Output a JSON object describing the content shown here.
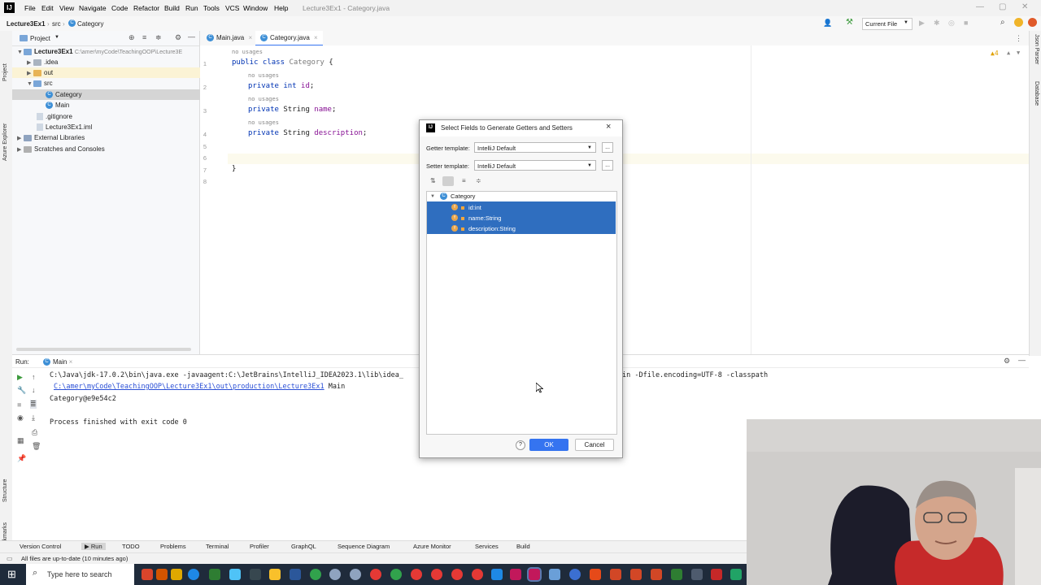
{
  "menubar": {
    "logo": "IJ",
    "items": [
      "File",
      "Edit",
      "View",
      "Navigate",
      "Code",
      "Refactor",
      "Build",
      "Run",
      "Tools",
      "VCS",
      "Window",
      "Help"
    ],
    "window_title": "Lecture3Ex1 - Category.java",
    "controls": [
      "—",
      "▢",
      "✕"
    ]
  },
  "navbar": {
    "breadcrumb": [
      "Lecture3Ex1",
      "src",
      "Category"
    ],
    "run_config": "Current File"
  },
  "left_stripe": {
    "project": "Project",
    "azure": "Azure Explorer",
    "structure": "Structure",
    "bookmarks": "Bookmarks"
  },
  "right_stripe": {
    "json": "Json Parser",
    "database": "Database"
  },
  "project_panel": {
    "title": "Project",
    "tree": [
      {
        "label": "Lecture3Ex1",
        "path": "C:\\amer\\myCode\\TeachingOOP\\Lecture3E",
        "bold": true
      },
      {
        "label": ".idea"
      },
      {
        "label": "out"
      },
      {
        "label": "src"
      },
      {
        "label": "Category"
      },
      {
        "label": "Main"
      },
      {
        "label": ".gitignore"
      },
      {
        "label": "Lecture3Ex1.iml"
      },
      {
        "label": "External Libraries"
      },
      {
        "label": "Scratches and Consoles"
      }
    ]
  },
  "editor": {
    "tabs": [
      "Main.java",
      "Category.java"
    ],
    "warnings": "▲4",
    "line_numbers": [
      "1",
      "2",
      "3",
      "4",
      "5",
      "6",
      "7",
      "8"
    ],
    "hints": [
      "no usages",
      "no usages",
      "no usages",
      "no usages"
    ],
    "lines": {
      "l1_kw": "public class ",
      "l1_name": "Category",
      "l1_end": " {",
      "l2_kw": "private int ",
      "l2_field": "id",
      "l2_end": ";",
      "l3_kw": "private ",
      "l3_type": "String ",
      "l3_field": "name",
      "l3_end": ";",
      "l4_kw": "private ",
      "l4_type": "String ",
      "l4_field": "description",
      "l4_end": ";",
      "l7": "}"
    }
  },
  "run_panel": {
    "label": "Run:",
    "tab": "Main",
    "cmd_left": "C:\\Java\\jdk-17.0.2\\bin\\java.exe -javaagent:C:\\JetBrains\\IntelliJ_IDEA2023.1\\lib\\idea_",
    "cmd_right": "in -Dfile.encoding=UTF-8 -classpath",
    "path_link": "C:\\amer\\myCode\\TeachingOOP\\Lecture3Ex1\\out\\production\\Lecture3Ex1",
    "path_suffix": " Main",
    "output": "Category@e9e54c2",
    "finished": "Process finished with exit code 0"
  },
  "tool_windows": [
    "Version Control",
    "Run",
    "TODO",
    "Problems",
    "Terminal",
    "Profiler",
    "GraphQL",
    "Sequence Diagram",
    "Azure Monitor",
    "Services",
    "Build"
  ],
  "status": "All files are up-to-date (10 minutes ago)",
  "taskbar": {
    "search_placeholder": "Type here to search"
  },
  "dialog": {
    "title": "Select Fields to Generate Getters and Setters",
    "getter_label": "Getter template:",
    "getter_value": "IntelliJ Default",
    "setter_label": "Setter template:",
    "setter_value": "IntelliJ Default",
    "more": "...",
    "class_node": "Category",
    "fields": [
      "id:int",
      "name:String",
      "description:String"
    ],
    "help": "?",
    "ok": "OK",
    "cancel": "Cancel"
  },
  "colors": {
    "selection": "#2f6ebf",
    "ok_button": "#3574f0",
    "accent": "#3574f0"
  }
}
